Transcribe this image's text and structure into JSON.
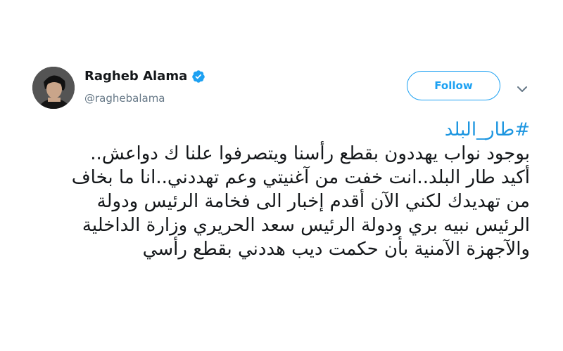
{
  "author": {
    "display_name": "Ragheb Alama",
    "handle": "@raghebalama",
    "verified": true,
    "avatar_icon": "profile-photo"
  },
  "actions": {
    "follow_label": "Follow",
    "menu_icon": "chevron-down-icon"
  },
  "tweet": {
    "hashtag": "#طار_البلد",
    "lines": [
      "بوجود نواب يهددون بقطع رأسنا ويتصرفوا علنا ك دواعش..",
      "أكيد طار البلد..انت خفت من آغنيتي وعم تهددني..انا ما بخاف",
      "من تهديدك لكني الآن أقدم إخبار الى فخامة الرئيس ودولة",
      "الرئيس نبيه بري ودولة الرئيس سعد الحريري وزارة الداخلية",
      "والآجهزة الآمنية بأن حكمت ديب هددني بقطع رأسي"
    ]
  },
  "colors": {
    "link": "#1b95e0",
    "follow": "#1da1f2",
    "text": "#14171a",
    "secondary": "#657786"
  }
}
